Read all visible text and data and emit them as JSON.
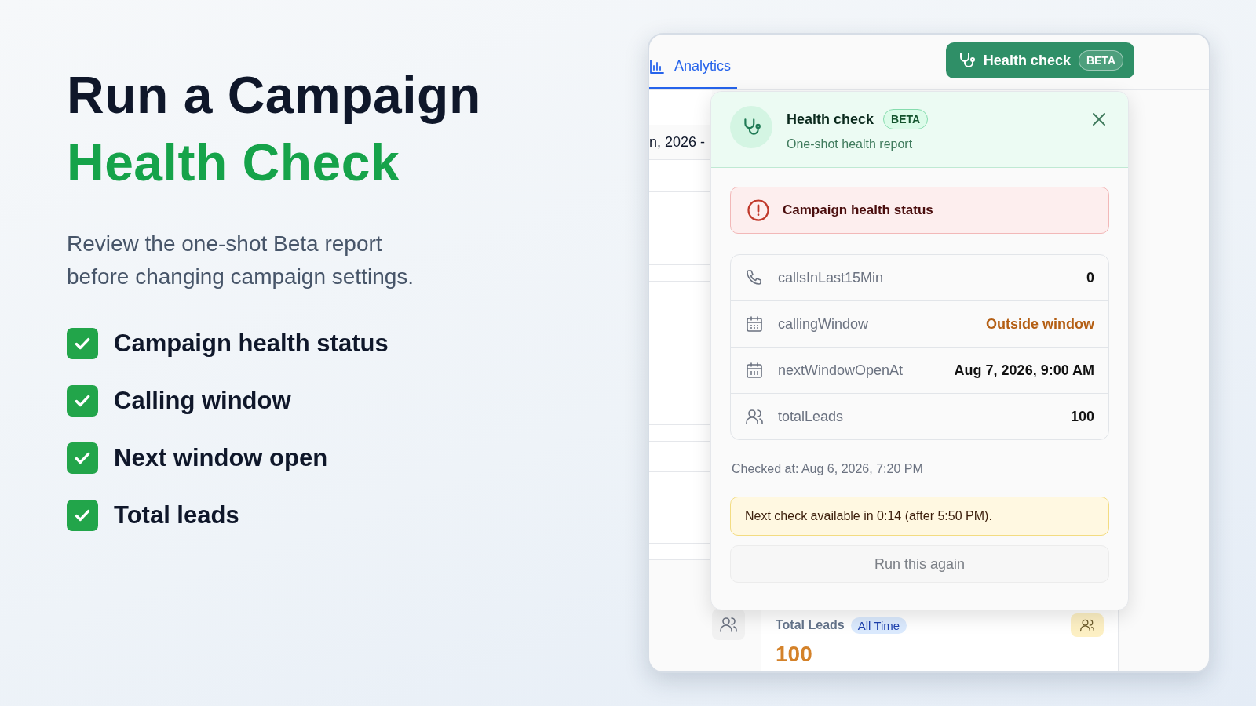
{
  "hero": {
    "title_line1": "Run a Campaign",
    "title_line2": "Health Check",
    "subtitle": "Review the one-shot Beta report before changing campaign settings.",
    "features": [
      {
        "label": "Campaign health status",
        "checked": true
      },
      {
        "label": "Calling window",
        "checked": true
      },
      {
        "label": "Next window open",
        "checked": true
      },
      {
        "label": "Total leads",
        "checked": true
      }
    ]
  },
  "app": {
    "tabs": [
      {
        "label": "Analytics",
        "selected": true
      }
    ],
    "date_range": "n, 2026 -",
    "health_button": {
      "label": "Health check",
      "badge": "BETA"
    },
    "popup": {
      "title": "Health check",
      "badge": "BETA",
      "subtitle": "One-shot health report",
      "status": {
        "label": "Campaign health status",
        "alert": true
      },
      "metrics": [
        {
          "kind": "phone",
          "label": "callsInLast15Min",
          "value": "0",
          "warning": false
        },
        {
          "kind": "calendar",
          "label": "callingWindow",
          "value": "Outside window",
          "warning": true
        },
        {
          "kind": "calendar",
          "label": "nextWindowOpenAt",
          "value": "Aug 7, 2026, 9:00 AM",
          "warning": false
        },
        {
          "kind": "users",
          "label": "totalLeads",
          "value": "100",
          "warning": false
        }
      ],
      "checked_at": "Checked at: Aug 6, 2026, 7:20 PM",
      "notice": "Next check available in 0:14 (after 5:50 PM).",
      "run_button": {
        "label": "Run this again",
        "disabled": true
      }
    },
    "stat_card": {
      "title": "Total Leads",
      "badge": "All Time",
      "value": "100"
    }
  }
}
